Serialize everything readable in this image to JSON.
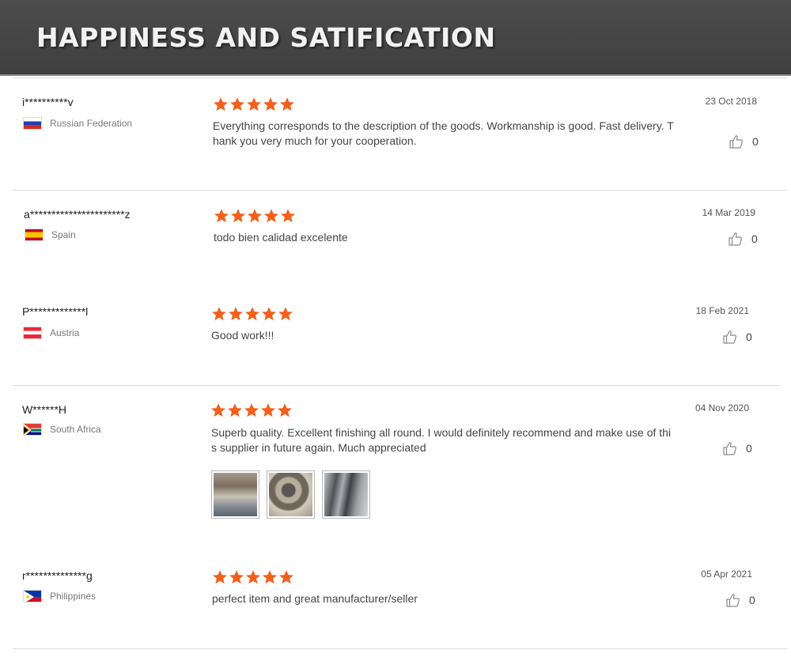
{
  "banner": {
    "title": "HAPPINESS AND SATIFICATION"
  },
  "reviews": [
    {
      "user": "i**********v",
      "country": "Russian Federation",
      "flag": "russia",
      "rating": 5,
      "date": "23 Oct 2018",
      "comment": "Everything corresponds to the description of the goods. Workmanship is good. Fast delivery. Thank you very much for your cooperation.",
      "likes": "0"
    },
    {
      "user": "a**********************z",
      "country": "Spain",
      "flag": "spain",
      "rating": 5,
      "date": "14 Mar 2019",
      "comment": "todo bien calidad excelente",
      "likes": "0"
    },
    {
      "user": "P*************l",
      "country": "Austria",
      "flag": "austria",
      "rating": 5,
      "date": "18 Feb 2021",
      "comment": "Good work!!!",
      "likes": "0"
    },
    {
      "user": "W******H",
      "country": "South Africa",
      "flag": "south-africa",
      "rating": 5,
      "date": "04 Nov 2020",
      "comment": "Superb quality. Excellent finishing all round. I would definitely recommend and make use of this supplier in future again. Much appreciated",
      "likes": "0",
      "photos": [
        "crankshaft-photo-1",
        "crankshaft-photo-2",
        "crankshaft-photo-3"
      ]
    },
    {
      "user": "r**************g",
      "country": "Philippines",
      "flag": "philippines",
      "rating": 5,
      "date": "05 Apr 2021",
      "comment": "perfect item and great manufacturer/seller",
      "likes": "0"
    }
  ],
  "colors": {
    "star": "#f2601c",
    "banner": "#464646"
  }
}
